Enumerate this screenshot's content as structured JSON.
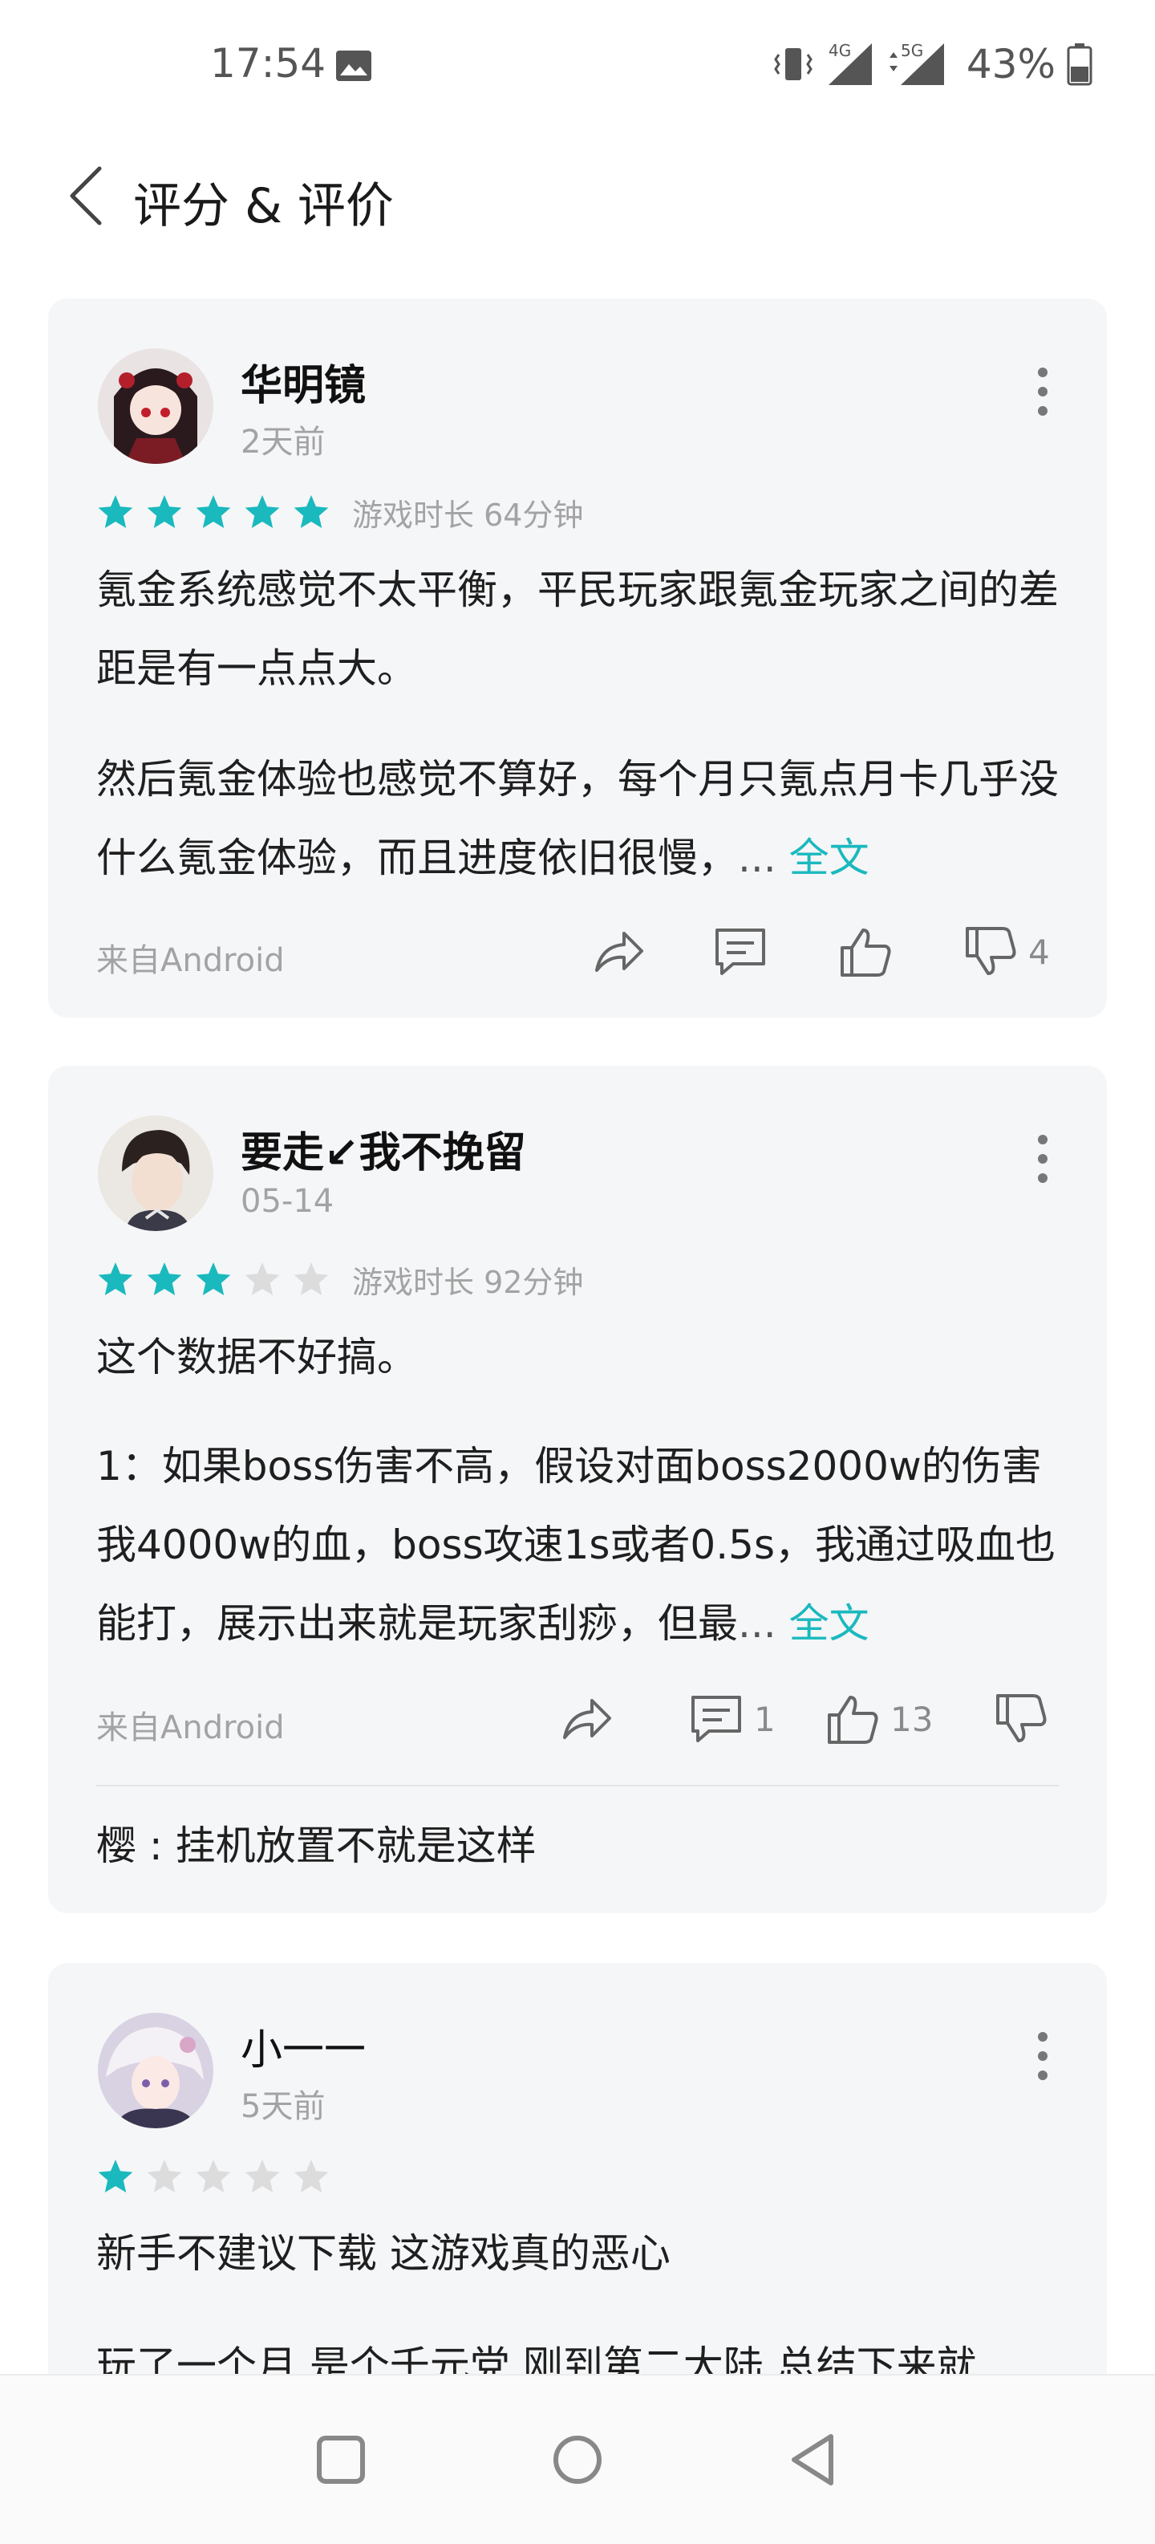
{
  "status_bar": {
    "time": "17:54",
    "network_1": "4G",
    "network_2": "5G",
    "battery": "43%"
  },
  "header": {
    "title": "评分 & 评价"
  },
  "reviews": [
    {
      "user": "华明镜",
      "date": "2天前",
      "rating": 5,
      "play_time": "游戏时长 64分钟",
      "paragraphs": [
        "氪金系统感觉不太平衡，平民玩家跟氪金玩家之间的差距是有一点点大。",
        "然后氪金体验也感觉不算好，每个月只氪点月卡几乎没什么氪金体验，而且进度依旧很慢，"
      ],
      "ellipsis": "...",
      "more_link": "全文",
      "source": "来自Android",
      "comment_count": "",
      "like_count": "",
      "dislike_count": "4"
    },
    {
      "user": "要走↙我不挽留",
      "date": "05-14",
      "rating": 3,
      "play_time": "游戏时长 92分钟",
      "paragraphs": [
        "这个数据不好搞。",
        "1：如果boss伤害不高，假设对面boss2000w的伤害我4000w的血，boss攻速1s或者0.5s，我通过吸血也能打，展示出来就是玩家刮痧，但最"
      ],
      "ellipsis": "...",
      "more_link": "全文",
      "source": "来自Android",
      "comment_count": "1",
      "like_count": "13",
      "dislike_count": "",
      "reply": "樱 : 挂机放置不就是这样"
    },
    {
      "user": "小一一",
      "date": "5天前",
      "rating": 1,
      "play_time": "",
      "paragraphs": [
        "新手不建议下载 这游戏真的恶心",
        "玩了一个月 是个千元党 刚到第二大陆 总结下来就"
      ]
    }
  ],
  "colors": {
    "accent": "#1ab9be",
    "star_on": "#1ab9be",
    "star_off": "#dcdcdc",
    "card_bg": "#f5f6f8",
    "muted_text": "#a3a3a3"
  },
  "icons": [
    "gallery-icon",
    "vibrate-icon",
    "signal-icon",
    "battery-icon",
    "back-arrow-icon",
    "more-vert-icon",
    "star-icon",
    "share-icon",
    "comment-icon",
    "thumbs-up-icon",
    "thumbs-down-icon",
    "nav-square-icon",
    "nav-circle-icon",
    "nav-triangle-icon"
  ]
}
